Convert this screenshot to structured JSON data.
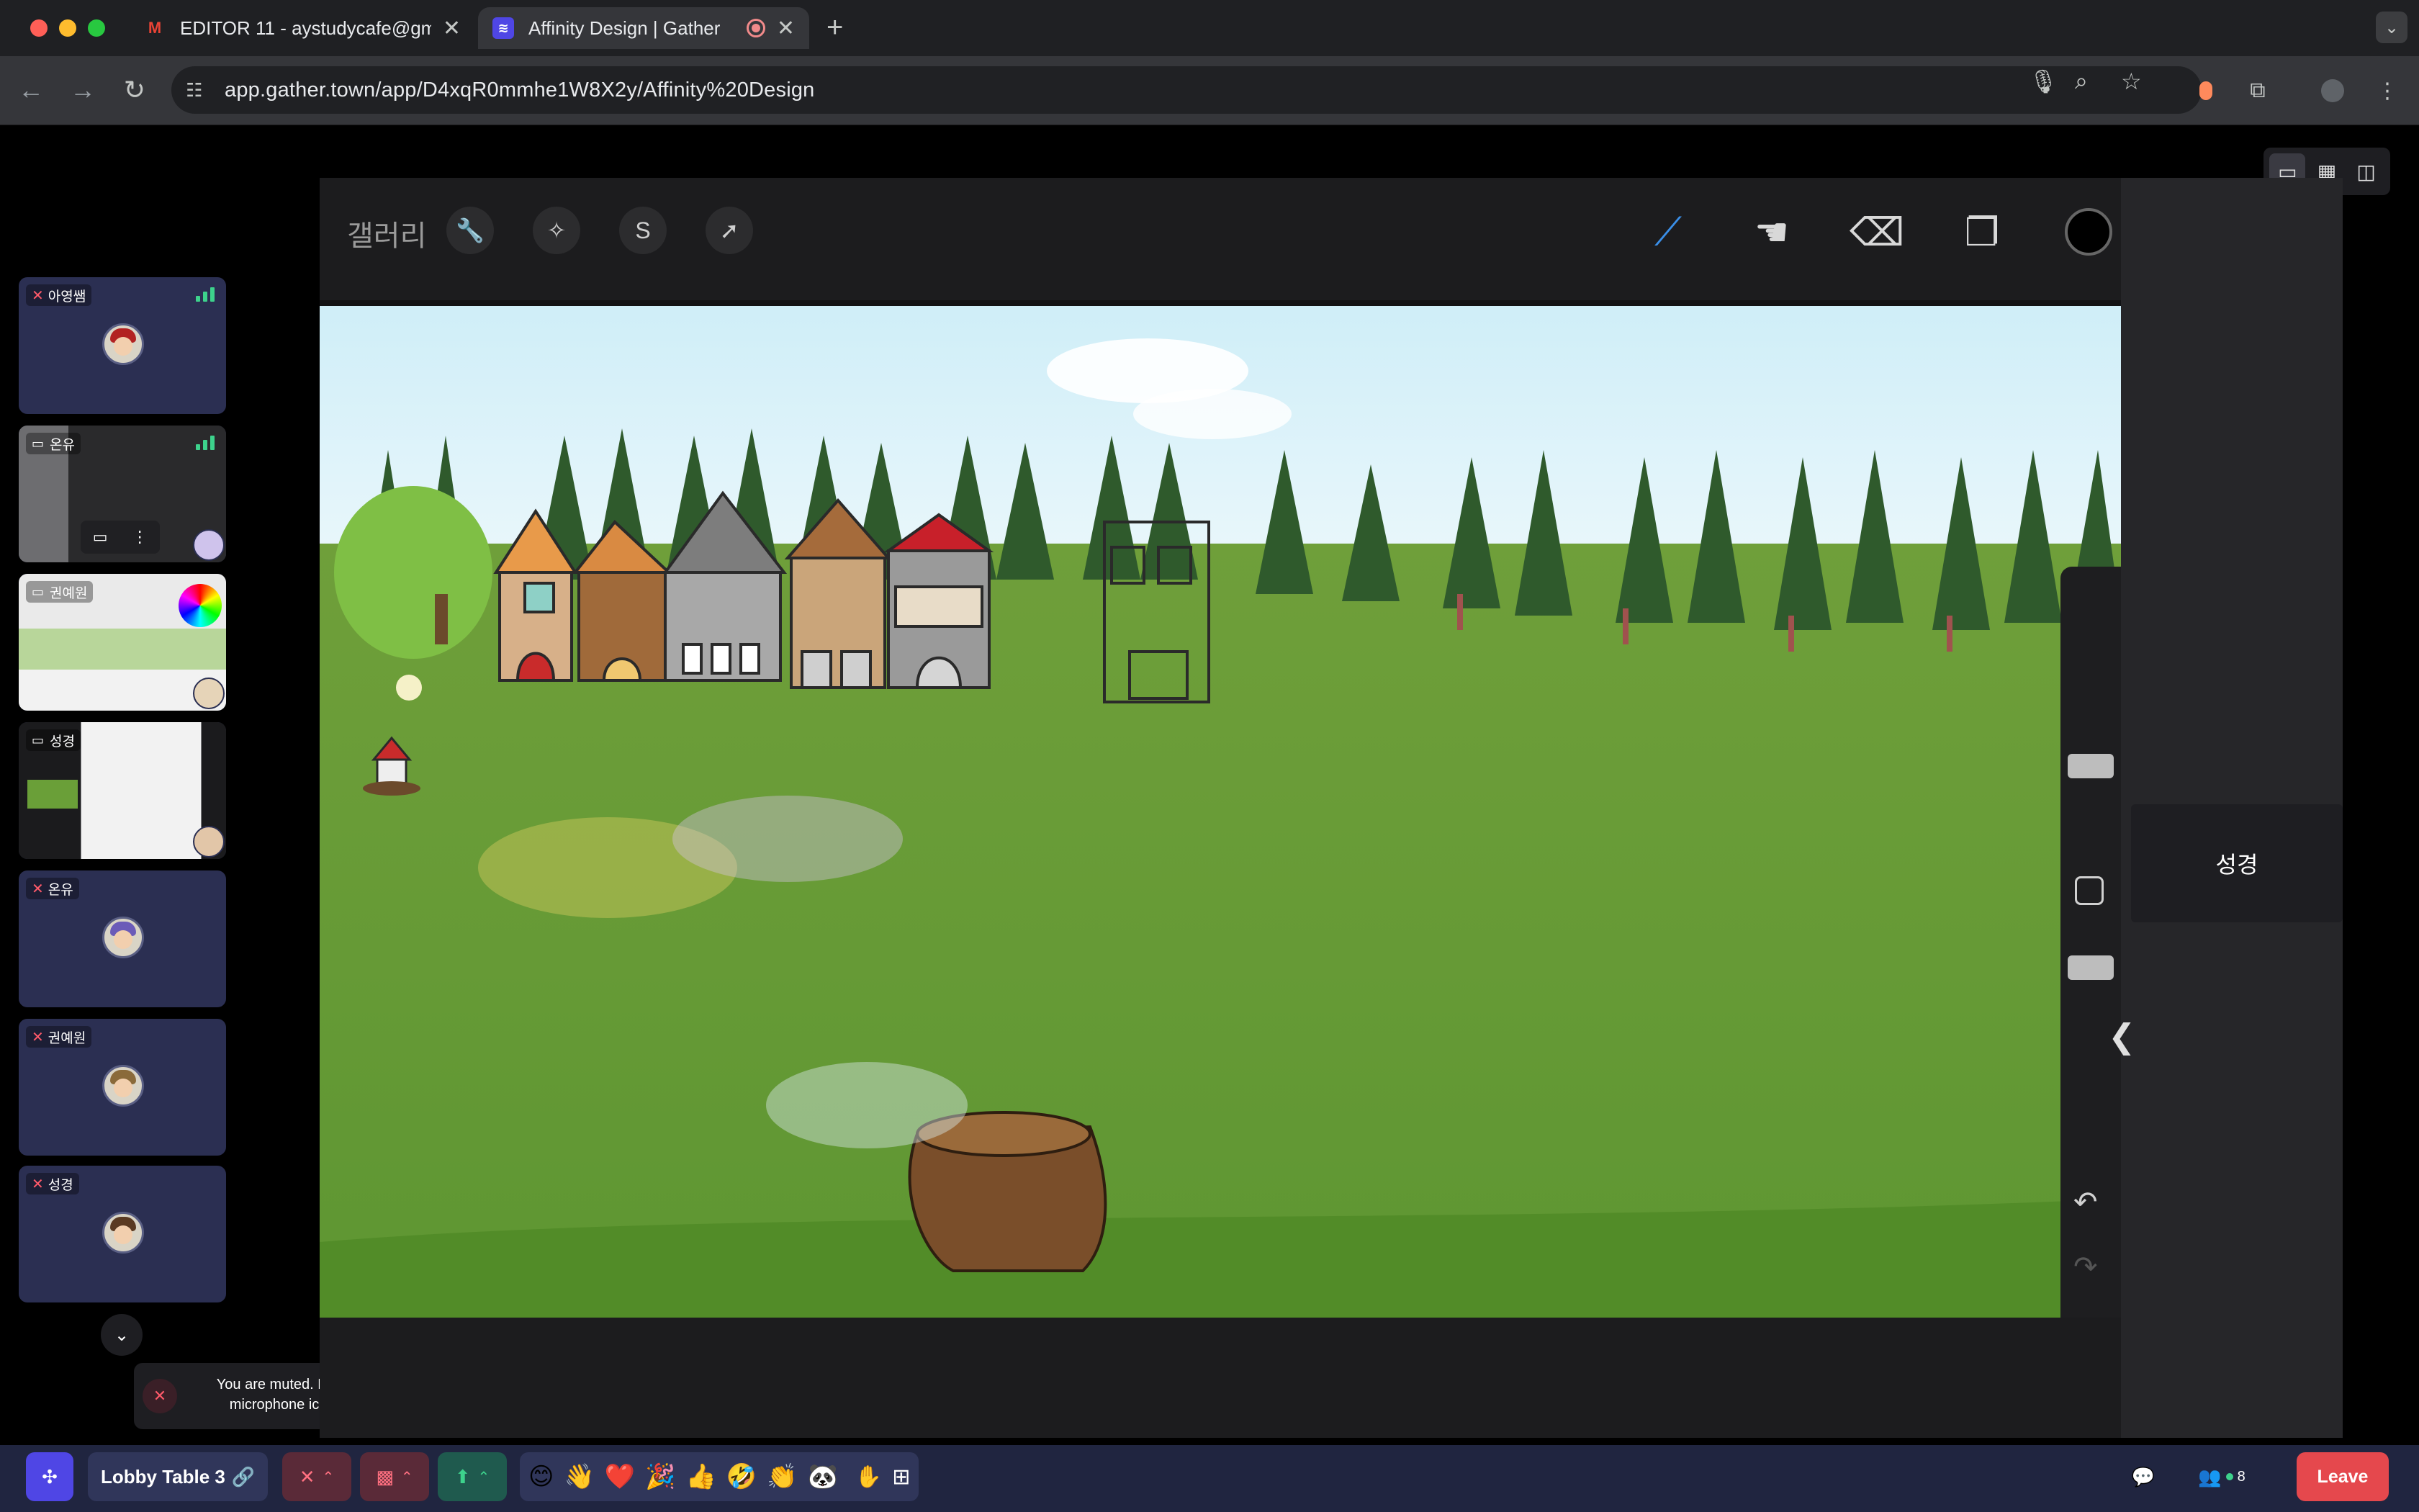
{
  "browser": {
    "tabs": [
      {
        "title": "EDITOR 11 - aystudycafe@gm",
        "favicon": "M",
        "favicon_name": "gmail-icon",
        "active": false
      },
      {
        "title": "Affinity Design | Gather",
        "favicon": "≋",
        "favicon_name": "gather-icon",
        "active": true
      }
    ],
    "url": "app.gather.town/app/D4xqR0mmhe1W8X2y/Affinity%20Design"
  },
  "participants": [
    {
      "name": "아영쌤",
      "muted": true,
      "sharing": false,
      "hair": "#b22222"
    },
    {
      "name": "온유",
      "muted": false,
      "sharing": true
    },
    {
      "name": "권예원",
      "muted": false,
      "sharing": true
    },
    {
      "name": "성경",
      "muted": false,
      "sharing": true
    },
    {
      "name": "온유",
      "muted": true,
      "sharing": false,
      "hair": "#6b5bb8"
    },
    {
      "name": "권예원",
      "muted": true,
      "sharing": false,
      "hair": "#8a6a3a"
    },
    {
      "name": "성경",
      "muted": true,
      "sharing": false,
      "hair": "#5a3a22"
    }
  ],
  "toast": {
    "text": "You are muted. Hit ⌘ ⇧ A or click on the microphone icon to unmute yourself."
  },
  "procreate": {
    "gallery_label": "갤러리"
  },
  "screen_label": "성경",
  "bottombar": {
    "room_name": "Lobby Table 3",
    "participant_count": "8",
    "leave_label": "Leave",
    "emojis": [
      "😊",
      "👋",
      "❤️",
      "🎉",
      "👍",
      "🤣",
      "👏",
      "🐼"
    ]
  },
  "colors": {
    "accent": "#4f46e5",
    "leave": "#e5484d",
    "signal": "#3dd28c",
    "muted": "#ff5a6a"
  }
}
